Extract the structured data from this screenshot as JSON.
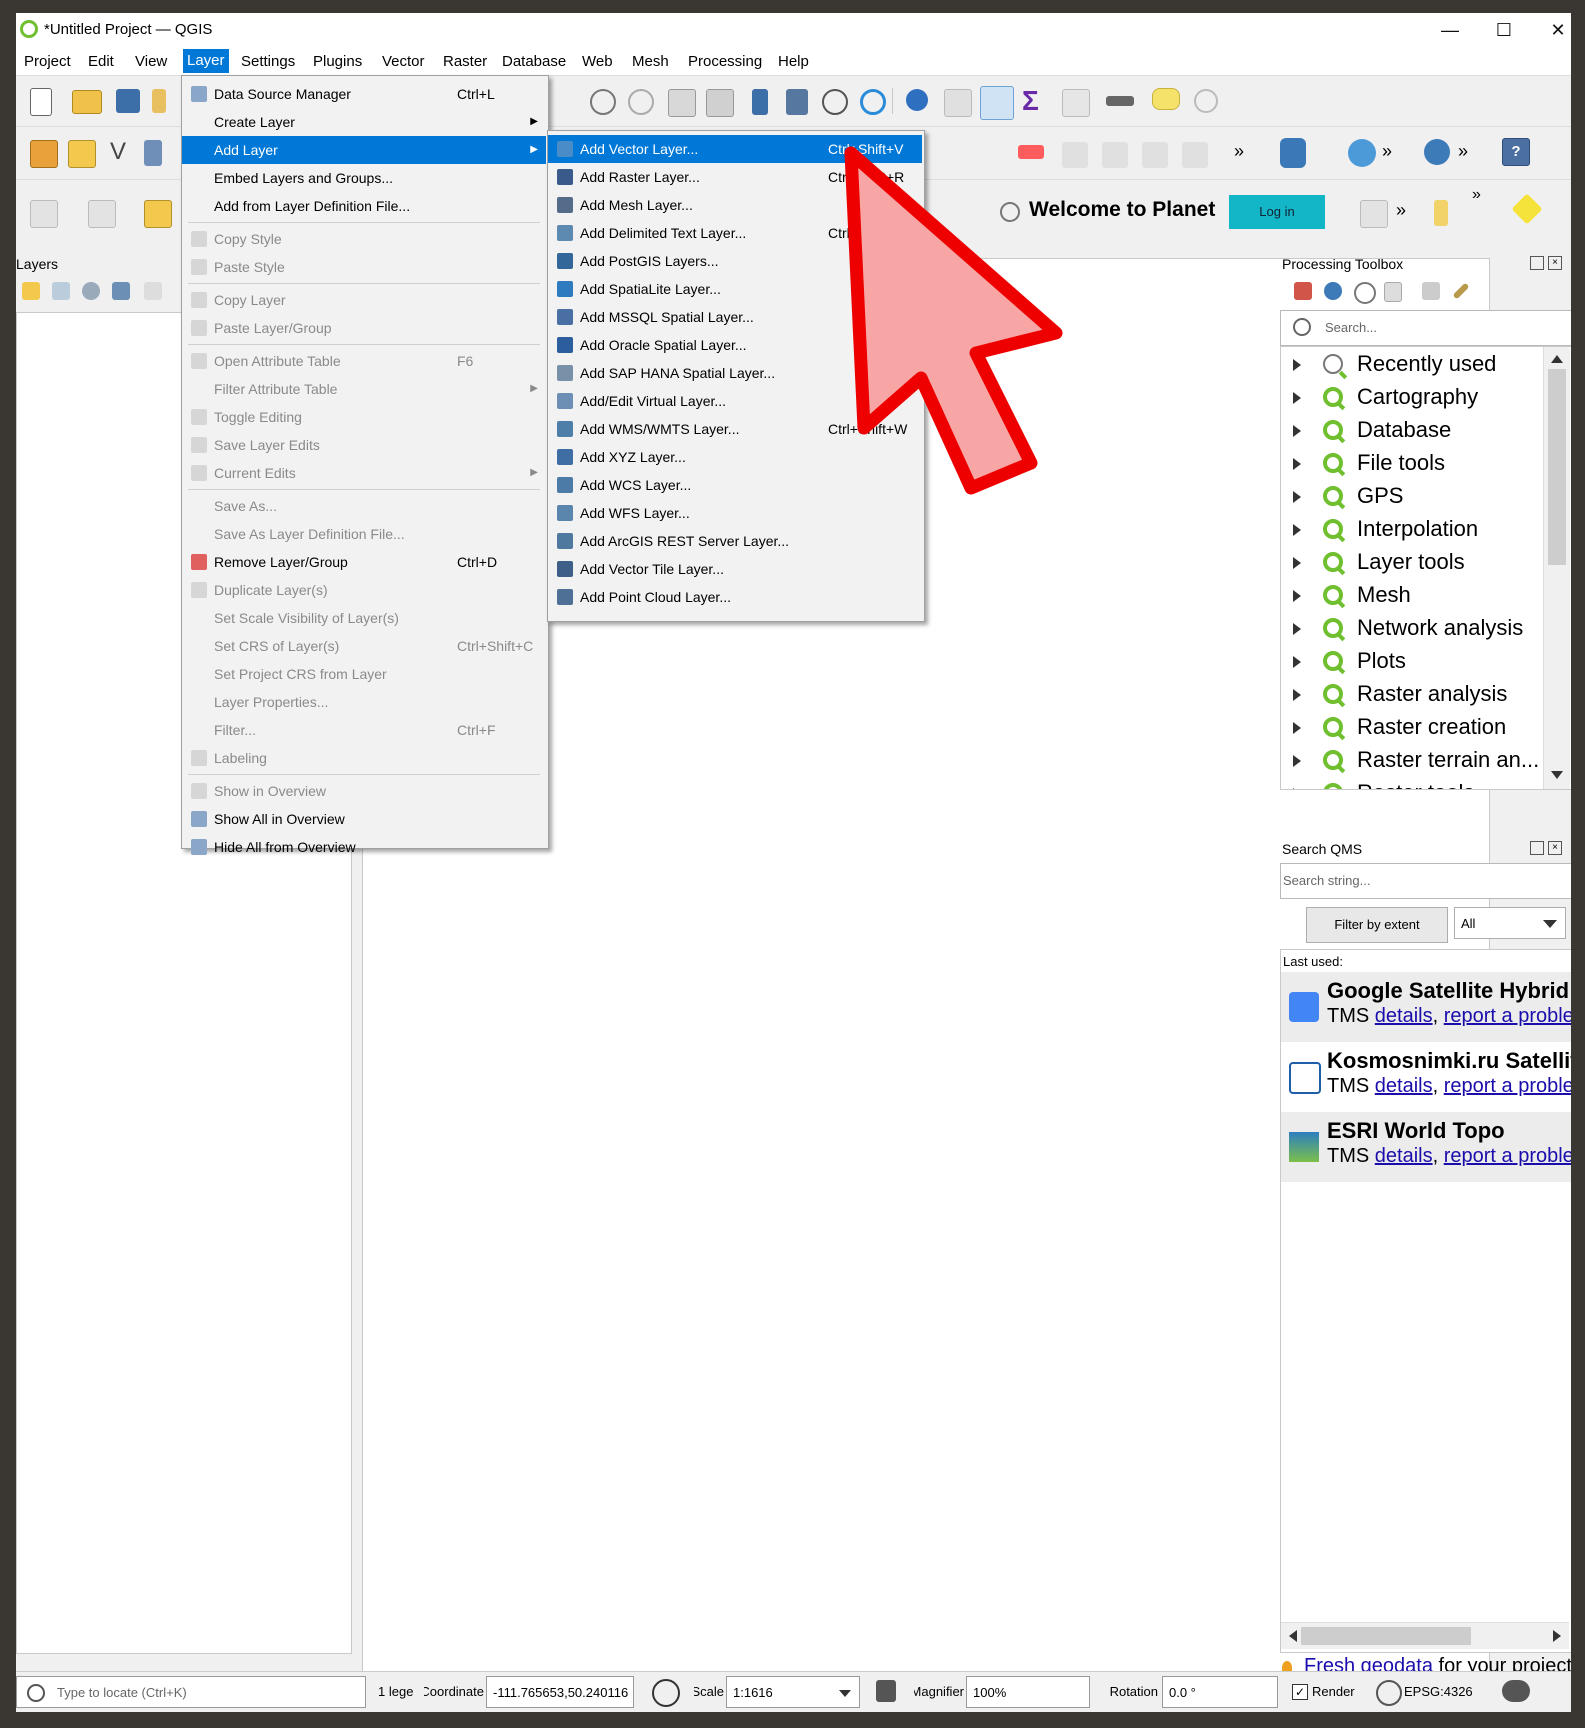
{
  "window": {
    "title": "*Untitled Project — QGIS",
    "minimize": "—",
    "maximize": "☐",
    "close": "✕"
  },
  "menubar": [
    "Project",
    "Edit",
    "View",
    "Layer",
    "Settings",
    "Plugins",
    "Vector",
    "Raster",
    "Database",
    "Web",
    "Mesh",
    "Processing",
    "Help"
  ],
  "toolbar": {
    "more": "»",
    "welcome": "Welcome to Planet",
    "login": "Log in"
  },
  "layer_menu": [
    {
      "label": "Data Source Manager",
      "shortcut": "Ctrl+L",
      "enabled": true,
      "icon": "data-source-icon"
    },
    {
      "label": "Create Layer",
      "submenu": true,
      "enabled": true
    },
    {
      "label": "Add Layer",
      "submenu": true,
      "enabled": true,
      "highlighted": true
    },
    {
      "label": "Embed Layers and Groups...",
      "enabled": true
    },
    {
      "label": "Add from Layer Definition File...",
      "enabled": true
    },
    {
      "sep": true
    },
    {
      "label": "Copy Style",
      "enabled": false,
      "icon": "copy-style-icon"
    },
    {
      "label": "Paste Style",
      "enabled": false,
      "icon": "paste-style-icon"
    },
    {
      "sep": true
    },
    {
      "label": "Copy Layer",
      "enabled": false,
      "icon": "copy-layer-icon"
    },
    {
      "label": "Paste Layer/Group",
      "enabled": false,
      "icon": "paste-layer-icon"
    },
    {
      "sep": true
    },
    {
      "label": "Open Attribute Table",
      "shortcut": "F6",
      "enabled": false,
      "icon": "attribute-table-icon"
    },
    {
      "label": "Filter Attribute Table",
      "submenu": true,
      "enabled": false
    },
    {
      "label": "Toggle Editing",
      "enabled": false,
      "icon": "pencil-icon"
    },
    {
      "label": "Save Layer Edits",
      "enabled": false,
      "icon": "save-edits-icon"
    },
    {
      "label": "Current Edits",
      "submenu": true,
      "enabled": false,
      "icon": "current-edits-icon"
    },
    {
      "sep": true
    },
    {
      "label": "Save As...",
      "enabled": false
    },
    {
      "label": "Save As Layer Definition File...",
      "enabled": false
    },
    {
      "label": "Remove Layer/Group",
      "shortcut": "Ctrl+D",
      "enabled": true,
      "icon": "remove-layer-icon"
    },
    {
      "label": "Duplicate Layer(s)",
      "enabled": false,
      "icon": "duplicate-icon"
    },
    {
      "label": "Set Scale Visibility of Layer(s)",
      "enabled": false
    },
    {
      "label": "Set CRS of Layer(s)",
      "shortcut": "Ctrl+Shift+C",
      "enabled": false
    },
    {
      "label": "Set Project CRS from Layer",
      "enabled": false
    },
    {
      "label": "Layer Properties...",
      "enabled": false
    },
    {
      "label": "Filter...",
      "shortcut": "Ctrl+F",
      "enabled": false
    },
    {
      "label": "Labeling",
      "enabled": false,
      "icon": "labeling-icon"
    },
    {
      "sep": true
    },
    {
      "label": "Show in Overview",
      "enabled": false,
      "icon": "overview-icon"
    },
    {
      "label": "Show All in Overview",
      "enabled": true,
      "icon": "show-all-overview-icon"
    },
    {
      "label": "Hide All from Overview",
      "enabled": true,
      "icon": "hide-all-overview-icon"
    }
  ],
  "add_layer_menu": [
    {
      "label": "Add Vector Layer...",
      "shortcut": "Ctrl+Shift+V",
      "highlighted": true,
      "icon": "vector-layer-icon",
      "color": "#4a8cc7"
    },
    {
      "label": "Add Raster Layer...",
      "shortcut": "Ctrl+Shift+R",
      "icon": "raster-layer-icon",
      "color": "#3b5a8c"
    },
    {
      "label": "Add Mesh Layer...",
      "icon": "mesh-layer-icon",
      "color": "#556b8a"
    },
    {
      "label": "Add Delimited Text Layer...",
      "shortcut": "Ctrl+Shift+T",
      "icon": "delimited-text-icon",
      "color": "#5d8ab0"
    },
    {
      "label": "Add PostGIS Layers...",
      "icon": "postgis-icon",
      "color": "#336699"
    },
    {
      "label": "Add SpatiaLite Layer...",
      "icon": "spatialite-icon",
      "color": "#2f7bbf"
    },
    {
      "label": "Add MSSQL Spatial Layer...",
      "icon": "mssql-icon",
      "color": "#4a6fa5"
    },
    {
      "label": "Add Oracle Spatial Layer...",
      "icon": "oracle-icon",
      "color": "#2c5e9e"
    },
    {
      "label": "Add SAP HANA Spatial Layer...",
      "icon": "sap-hana-icon",
      "color": "#7890a8"
    },
    {
      "label": "Add/Edit Virtual Layer...",
      "icon": "virtual-layer-icon",
      "color": "#6d8fb5"
    },
    {
      "label": "Add WMS/WMTS Layer...",
      "shortcut": "Ctrl+Shift+W",
      "icon": "wms-icon",
      "color": "#4d7fa8"
    },
    {
      "label": "Add XYZ Layer...",
      "icon": "xyz-icon",
      "color": "#3e6ea3"
    },
    {
      "label": "Add WCS Layer...",
      "icon": "wcs-icon",
      "color": "#4b7ba6"
    },
    {
      "label": "Add WFS Layer...",
      "icon": "wfs-icon",
      "color": "#5a86ad"
    },
    {
      "label": "Add ArcGIS REST Server Layer...",
      "icon": "arcgis-rest-icon",
      "color": "#5079a0"
    },
    {
      "label": "Add Vector Tile Layer...",
      "icon": "vector-tile-icon",
      "color": "#3d5f88"
    },
    {
      "label": "Add Point Cloud Layer...",
      "icon": "point-cloud-icon",
      "color": "#4e6f96"
    }
  ],
  "layers_panel": {
    "title": "Layers"
  },
  "processing": {
    "title": "Processing Toolbox",
    "search_placeholder": "Search...",
    "items": [
      "Recently used",
      "Cartography",
      "Database",
      "File tools",
      "GPS",
      "Interpolation",
      "Layer tools",
      "Mesh",
      "Network analysis",
      "Plots",
      "Raster analysis",
      "Raster creation",
      "Raster terrain an...",
      "Raster tools"
    ]
  },
  "qms": {
    "title": "Search QMS",
    "search_placeholder": "Search string...",
    "filter_button": "Filter by extent",
    "filter_select": "All",
    "last_used": "Last used:",
    "items": [
      {
        "name": "Google Satellite Hybrid",
        "type": "TMS",
        "details": "details",
        "report": "report a proble"
      },
      {
        "name": "Kosmosnimki.ru Satellite",
        "type": "TMS",
        "details": "details",
        "report": "report a proble"
      },
      {
        "name": "ESRI World Topo",
        "type": "TMS",
        "details": "details",
        "report": "report a proble"
      }
    ],
    "footer_link": "Fresh geodata",
    "footer_text": " for your project"
  },
  "statusbar": {
    "locate_placeholder": "Type to locate (Ctrl+K)",
    "legend": "1 lege",
    "coordinate_label": "Coordinate",
    "coordinate": "-111.765653,50.240116",
    "scale_label": "Scale",
    "scale": "1:1616",
    "magnifier_label": "Magnifier",
    "magnifier": "100%",
    "rotation_label": "Rotation",
    "rotation": "0.0 °",
    "render": "Render",
    "crs": "EPSG:4326"
  },
  "colors": {
    "accent": "#0078d7",
    "qgis_green": "#6fbf2e",
    "arrow_fill": "#f7a5a5",
    "arrow_stroke": "#ee0000",
    "login": "#12b6c6"
  }
}
